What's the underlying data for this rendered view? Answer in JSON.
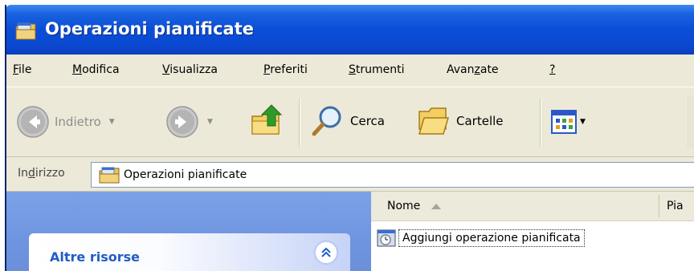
{
  "window": {
    "title": "Operazioni pianificate",
    "title_icon": "scheduled-tasks-folder-icon"
  },
  "menu": [
    {
      "pre": "",
      "ul": "F",
      "post": "ile"
    },
    {
      "pre": "",
      "ul": "M",
      "post": "odifica"
    },
    {
      "pre": "",
      "ul": "V",
      "post": "isualizza"
    },
    {
      "pre": "",
      "ul": "P",
      "post": "referiti"
    },
    {
      "pre": "",
      "ul": "S",
      "post": "trumenti"
    },
    {
      "pre": "Avan",
      "ul": "z",
      "post": "ate"
    },
    {
      "pre": "",
      "ul": "?",
      "post": ""
    }
  ],
  "toolbar": {
    "back_label": "Indietro",
    "search_label": "Cerca",
    "folders_label": "Cartelle"
  },
  "address": {
    "label_pre": "In",
    "label_ul": "d",
    "label_post": "irizzo",
    "value": "Operazioni pianificate"
  },
  "taskpane": {
    "section_title": "Altre risorse",
    "collapse_icon": "chevron-double-up-icon"
  },
  "filelist": {
    "columns": [
      "Nome",
      "Pia"
    ],
    "items": [
      {
        "label": "Aggiungi operazione pianificata",
        "icon": "add-task-icon"
      }
    ]
  },
  "colors": {
    "titlebar": "#0a4ed8",
    "chrome": "#ece9d8",
    "taskpane": "#6f95e1",
    "pane_title": "#215dc6"
  }
}
